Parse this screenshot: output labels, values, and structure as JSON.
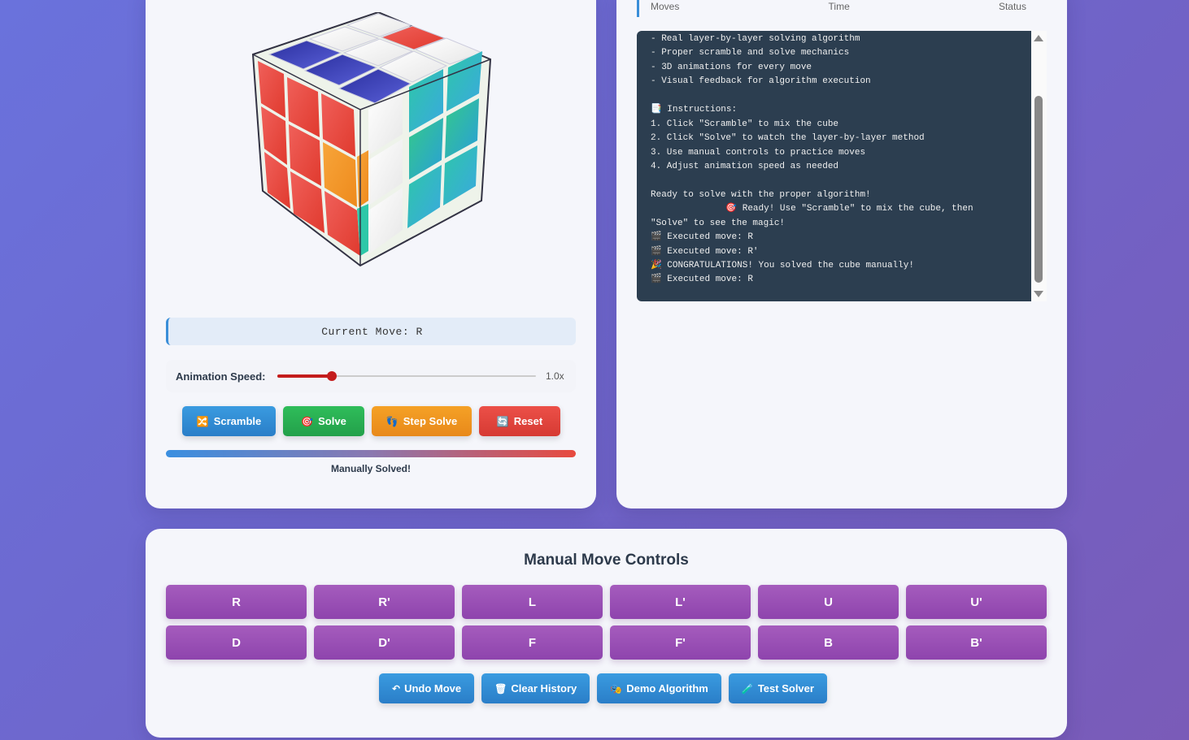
{
  "cube_panel": {
    "current_move_label": "Current Move: R",
    "speed_label": "Animation Speed:",
    "speed_value": "1.0x",
    "speed_fraction": 0.21,
    "actions": [
      {
        "label": "Scramble",
        "icon": "shuffle-icon",
        "glyph": "🔀"
      },
      {
        "label": "Solve",
        "icon": "target-icon",
        "glyph": "🎯"
      },
      {
        "label": "Step Solve",
        "icon": "footprints-icon",
        "glyph": "👣"
      },
      {
        "label": "Reset",
        "icon": "refresh-icon",
        "glyph": "🔄"
      }
    ],
    "status_text": "Manually Solved!"
  },
  "history_panel": {
    "columns": [
      "Moves",
      "Time",
      "Status"
    ],
    "console_lines": [
      "- Real layer-by-layer solving algorithm",
      "- Proper scramble and solve mechanics",
      "- 3D animations for every move",
      "- Visual feedback for algorithm execution",
      "",
      "📑 Instructions:",
      "1. Click \"Scramble\" to mix the cube",
      "2. Click \"Solve\" to watch the layer-by-layer method",
      "3. Use manual controls to practice moves",
      "4. Adjust animation speed as needed",
      "",
      "Ready to solve with the proper algorithm!",
      "              🎯 Ready! Use \"Scramble\" to mix the cube, then",
      "\"Solve\" to see the magic!",
      "🎬 Executed move: R",
      "🎬 Executed move: R'",
      "🎉 CONGRATULATIONS! You solved the cube manually!",
      "🎬 Executed move: R"
    ]
  },
  "manual_controls": {
    "title": "Manual Move Controls",
    "moves": [
      "R",
      "R'",
      "L",
      "L'",
      "U",
      "U'",
      "D",
      "D'",
      "F",
      "F'",
      "B",
      "B'"
    ],
    "utilities": [
      {
        "label": "Undo Move",
        "icon": "undo-icon",
        "glyph": "↶"
      },
      {
        "label": "Clear History",
        "icon": "trash-icon",
        "glyph": "🗑"
      },
      {
        "label": "Demo Algorithm",
        "icon": "demo-icon",
        "glyph": "🎭"
      },
      {
        "label": "Test Solver",
        "icon": "test-tube-icon",
        "glyph": "🧪"
      }
    ]
  },
  "colors": {
    "background_start": "#6a72dc",
    "background_end": "#7a5bb8",
    "move_button": "#9b4fb8",
    "console_bg": "#2c3e50",
    "cube_red": "#e84a3e",
    "cube_white": "#f4f4f4",
    "cube_blue": "#2e35a8",
    "cube_teal": "#2cc3b0",
    "cube_orange": "#f39322"
  }
}
